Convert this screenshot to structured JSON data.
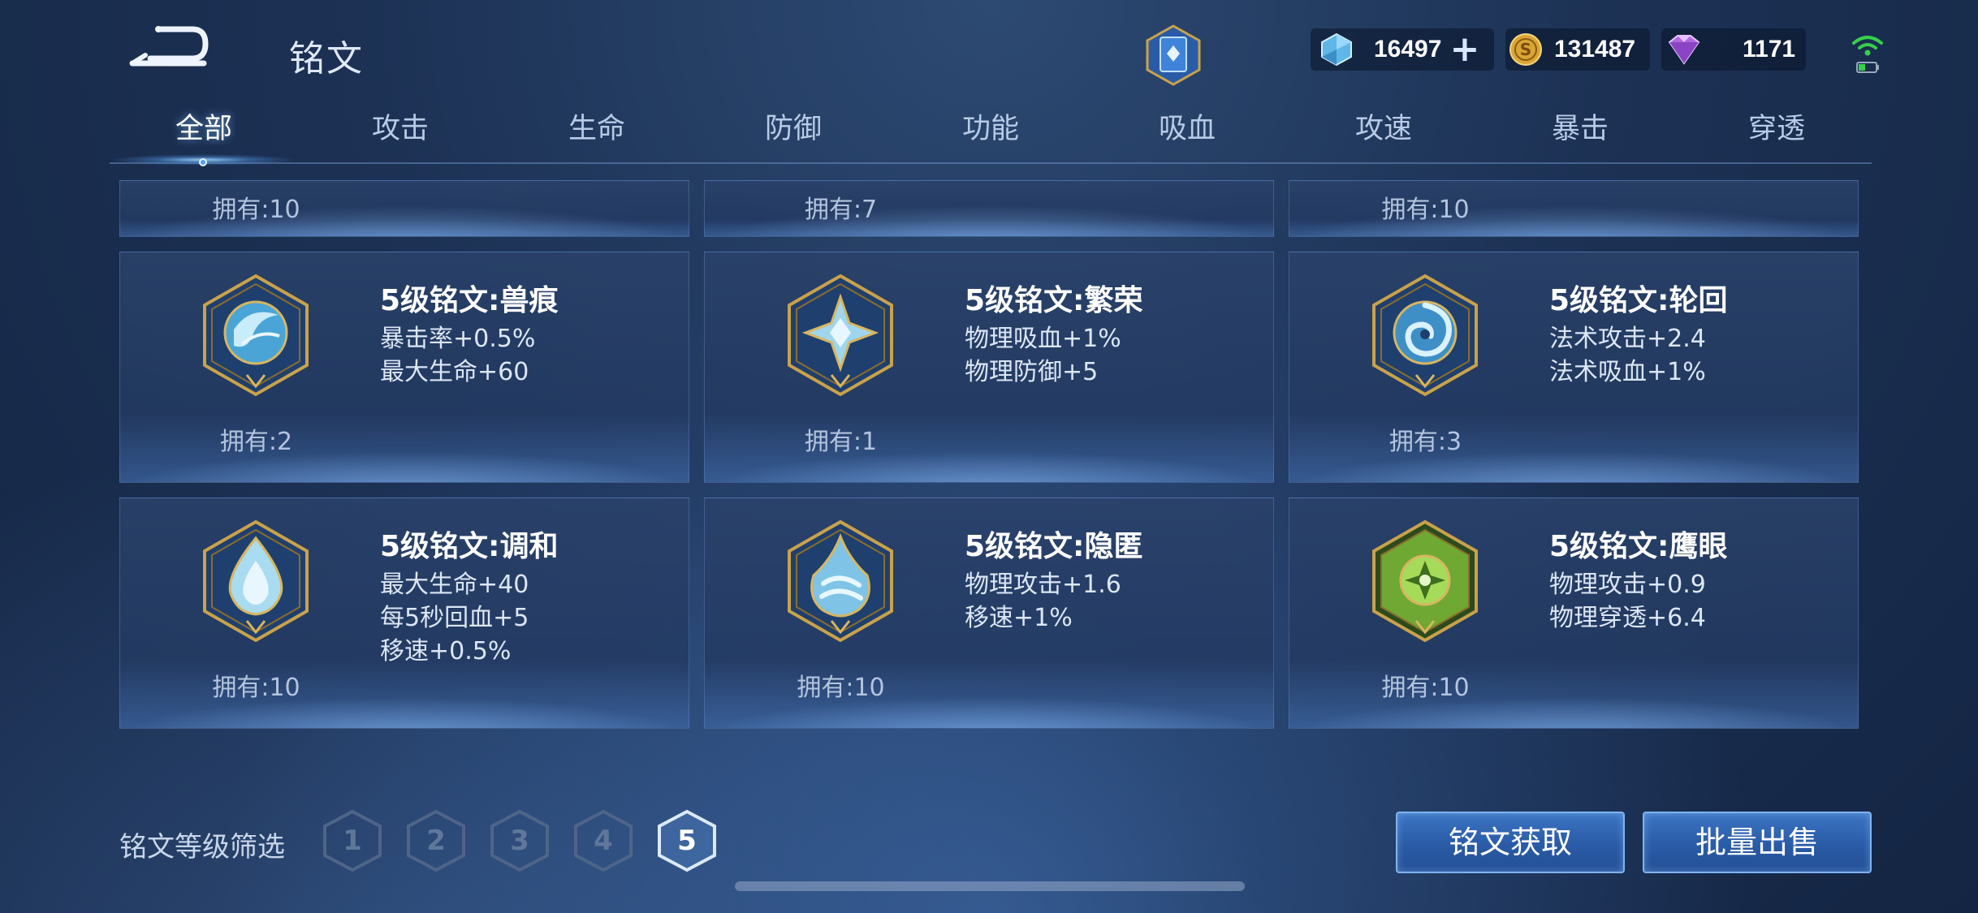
{
  "header": {
    "title": "铭文",
    "currencies": [
      {
        "icon": "crystal-icon",
        "value": "16497",
        "has_plus": true
      },
      {
        "icon": "gold-coin-icon",
        "value": "131487"
      },
      {
        "icon": "purple-gem-icon",
        "value": "1171"
      }
    ]
  },
  "tabs": [
    {
      "label": "全部",
      "active": true
    },
    {
      "label": "攻击"
    },
    {
      "label": "生命"
    },
    {
      "label": "防御"
    },
    {
      "label": "功能"
    },
    {
      "label": "吸血"
    },
    {
      "label": "攻速"
    },
    {
      "label": "暴击"
    },
    {
      "label": "穿透"
    }
  ],
  "partial_row": [
    {
      "owned": "拥有:10"
    },
    {
      "owned": "拥有:7"
    },
    {
      "owned": "拥有:10"
    }
  ],
  "cards": [
    {
      "name": "5级铭文:兽痕",
      "attrs": [
        "暴击率+0.5%",
        "最大生命+60"
      ],
      "owned": "拥有:2",
      "icon": "beast-mark-icon",
      "color": "#7fc9ea"
    },
    {
      "name": "5级铭文:繁荣",
      "attrs": [
        "物理吸血+1%",
        "物理防御+5"
      ],
      "owned": "拥有:1",
      "icon": "prosperity-icon",
      "color": "#a9dcf0"
    },
    {
      "name": "5级铭文:轮回",
      "attrs": [
        "法术攻击+2.4",
        "法术吸血+1%"
      ],
      "owned": "拥有:3",
      "icon": "reincarnation-icon",
      "color": "#8fd2f2"
    },
    {
      "name": "5级铭文:调和",
      "attrs": [
        "最大生命+40",
        "每5秒回血+5",
        "移速+0.5%"
      ],
      "owned": "拥有:10",
      "icon": "harmony-icon",
      "color": "#bfe6f6"
    },
    {
      "name": "5级铭文:隐匿",
      "attrs": [
        "物理攻击+1.6",
        "移速+1%"
      ],
      "owned": "拥有:10",
      "icon": "stealth-icon",
      "color": "#9ad8f2"
    },
    {
      "name": "5级铭文:鹰眼",
      "attrs": [
        "物理攻击+0.9",
        "物理穿透+6.4"
      ],
      "owned": "拥有:10",
      "icon": "eagle-eye-icon",
      "color": "#8cc63f"
    }
  ],
  "footer": {
    "filter_label": "铭文等级筛选",
    "levels": [
      "1",
      "2",
      "3",
      "4",
      "5"
    ],
    "selected_level": "5",
    "obtain_button": "铭文获取",
    "bulk_sell_button": "批量出售"
  },
  "colors": {
    "accent": "#2a5ba6",
    "gold_frame": "#c9a24a",
    "eagle_green": "#8cc63f"
  }
}
